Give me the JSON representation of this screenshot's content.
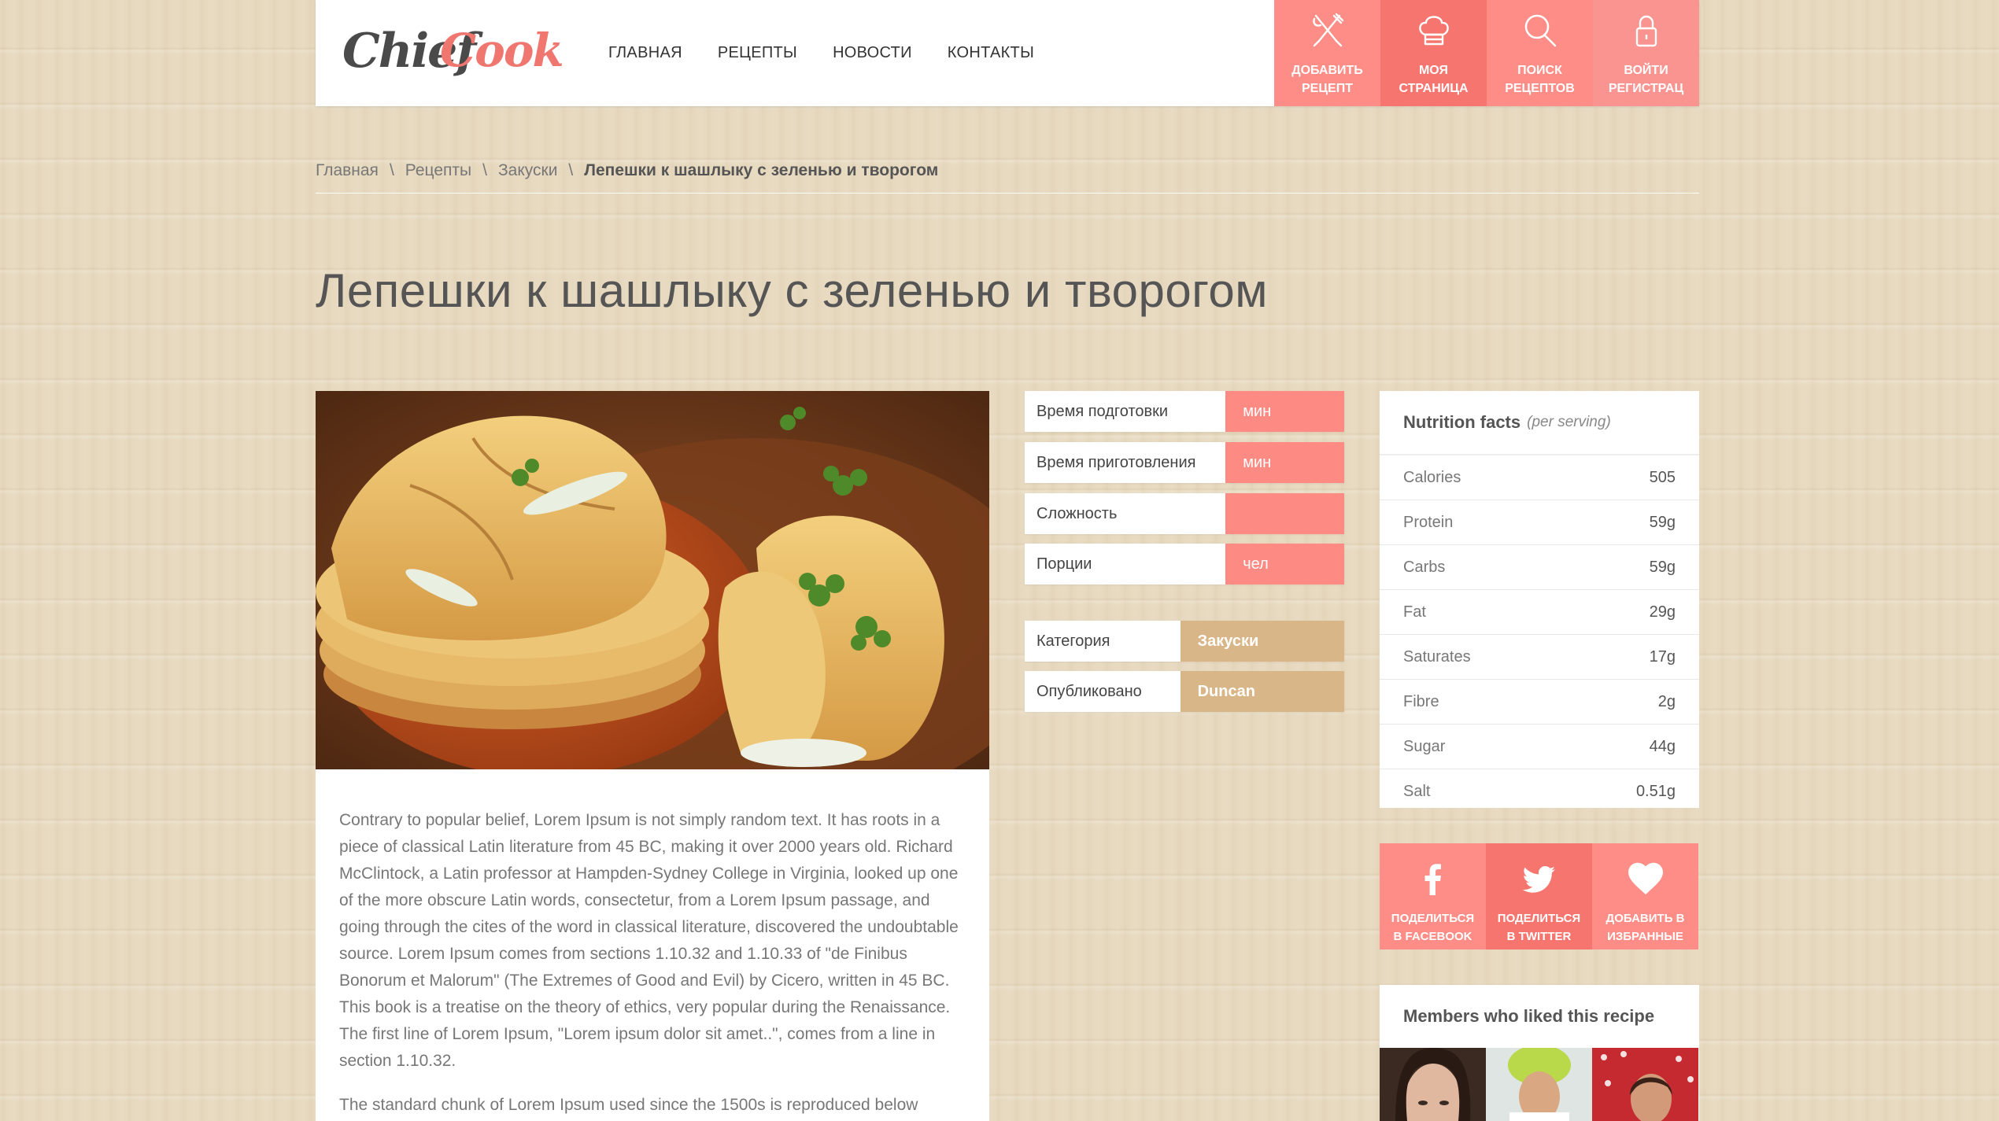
{
  "brand": {
    "logo_part1": "Chief",
    "logo_part2": "Cook"
  },
  "nav": [
    "ГЛАВНАЯ",
    "РЕЦЕПТЫ",
    "НОВОСТИ",
    "КОНТАКТЫ"
  ],
  "actions": [
    {
      "icon": "fork-knife-icon",
      "line1": "ДОБАВИТЬ",
      "line2": "РЕЦЕПТ"
    },
    {
      "icon": "chef-hat-icon",
      "line1": "МОЯ",
      "line2": "СТРАНИЦА"
    },
    {
      "icon": "search-icon",
      "line1": "ПОИСК",
      "line2": "РЕЦЕПТОВ"
    },
    {
      "icon": "lock-icon",
      "line1": "ВОЙТИ",
      "line2": "РЕГИСТРАЦ"
    }
  ],
  "breadcrumb": {
    "items": [
      "Главная",
      "Рецепты",
      "Закуски"
    ],
    "current": "Лепешки к шашлыку с зеленью и творогом",
    "separator": "\\"
  },
  "title": "Лепешки к шашлыку с зеленью и творогом",
  "recipe_info": [
    {
      "label": "Время подготовки",
      "value": "мин"
    },
    {
      "label": "Время приготовления",
      "value": "мин"
    },
    {
      "label": "Сложность",
      "value": ""
    },
    {
      "label": "Порции",
      "value": "чел"
    }
  ],
  "meta_info": [
    {
      "label": "Категория",
      "value": "Закуски"
    },
    {
      "label": "Опубликовано",
      "value": "Duncan"
    }
  ],
  "content": {
    "p1": "Contrary to popular belief, Lorem Ipsum is not simply random text. It has roots in a piece of classical Latin literature from 45 BC, making it over 2000 years old. Richard McClintock, a Latin professor at Hampden-Sydney College in Virginia, looked up one of the more obscure Latin words, consectetur, from a Lorem Ipsum passage, and going through the cites of the word in classical literature, discovered the undoubtable source. Lorem Ipsum comes from sections 1.10.32 and 1.10.33 of \"de Finibus Bonorum et Malorum\" (The Extremes of Good and Evil) by Cicero, written in 45 BC. This book is a treatise on the theory of ethics, very popular during the Renaissance. The first line of Lorem Ipsum, \"Lorem ipsum dolor sit amet..\", comes from a line in section 1.10.32.",
    "p2": "The standard chunk of Lorem Ipsum used since the 1500s is reproduced below"
  },
  "nutrition": {
    "title": "Nutrition facts",
    "subtitle": "(per serving)",
    "rows": [
      {
        "name": "Calories",
        "value": "505"
      },
      {
        "name": "Protein",
        "value": "59g"
      },
      {
        "name": "Carbs",
        "value": "59g"
      },
      {
        "name": "Fat",
        "value": "29g"
      },
      {
        "name": "Saturates",
        "value": "17g"
      },
      {
        "name": "Fibre",
        "value": "2g"
      },
      {
        "name": "Sugar",
        "value": "44g"
      },
      {
        "name": "Salt",
        "value": "0.51g"
      }
    ]
  },
  "share": [
    {
      "icon": "facebook-icon",
      "line1": "ПОДЕЛИТЬСЯ",
      "line2": "В FACEBOOK"
    },
    {
      "icon": "twitter-icon",
      "line1": "ПОДЕЛИТЬСЯ",
      "line2": "В TWITTER"
    },
    {
      "icon": "heart-icon",
      "line1": "ДОБАВИТЬ В",
      "line2": "ИЗБРАННЫЕ"
    }
  ],
  "members": {
    "title": "Members who liked this recipe"
  },
  "colors": {
    "accent": "#fd8d86",
    "accent_dark": "#f6756e",
    "tan": "#d9b687",
    "logo_accent": "#f07670"
  }
}
